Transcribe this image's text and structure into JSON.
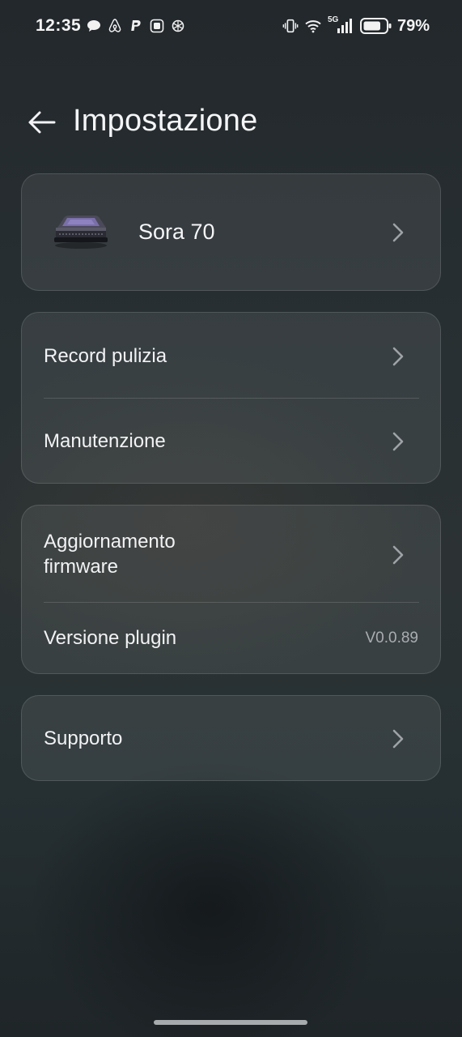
{
  "status_bar": {
    "time": "12:35",
    "battery_percent": "79%",
    "network_label": "5G",
    "notification_icons": [
      "chat-bubble-icon",
      "airbnb-icon",
      "paypal-icon",
      "app-icon",
      "openai-icon"
    ],
    "system_icons": [
      "vibrate-icon",
      "wifi-icon",
      "signal-5g-icon",
      "battery-icon"
    ]
  },
  "header": {
    "title": "Impostazione"
  },
  "device": {
    "name": "Sora 70"
  },
  "group1": {
    "items": [
      {
        "label": "Record pulizia"
      },
      {
        "label": "Manutenzione"
      }
    ]
  },
  "group2": {
    "items": [
      {
        "label": "Aggiornamento firmware"
      },
      {
        "label": "Versione plugin",
        "value": "V0.0.89"
      }
    ]
  },
  "group3": {
    "items": [
      {
        "label": "Supporto"
      }
    ]
  },
  "colors": {
    "background": "#283033",
    "card": "#3a4044",
    "text": "#f2f3f5",
    "secondary_text": "#a9adb1",
    "chevron": "#9ea3a7"
  }
}
